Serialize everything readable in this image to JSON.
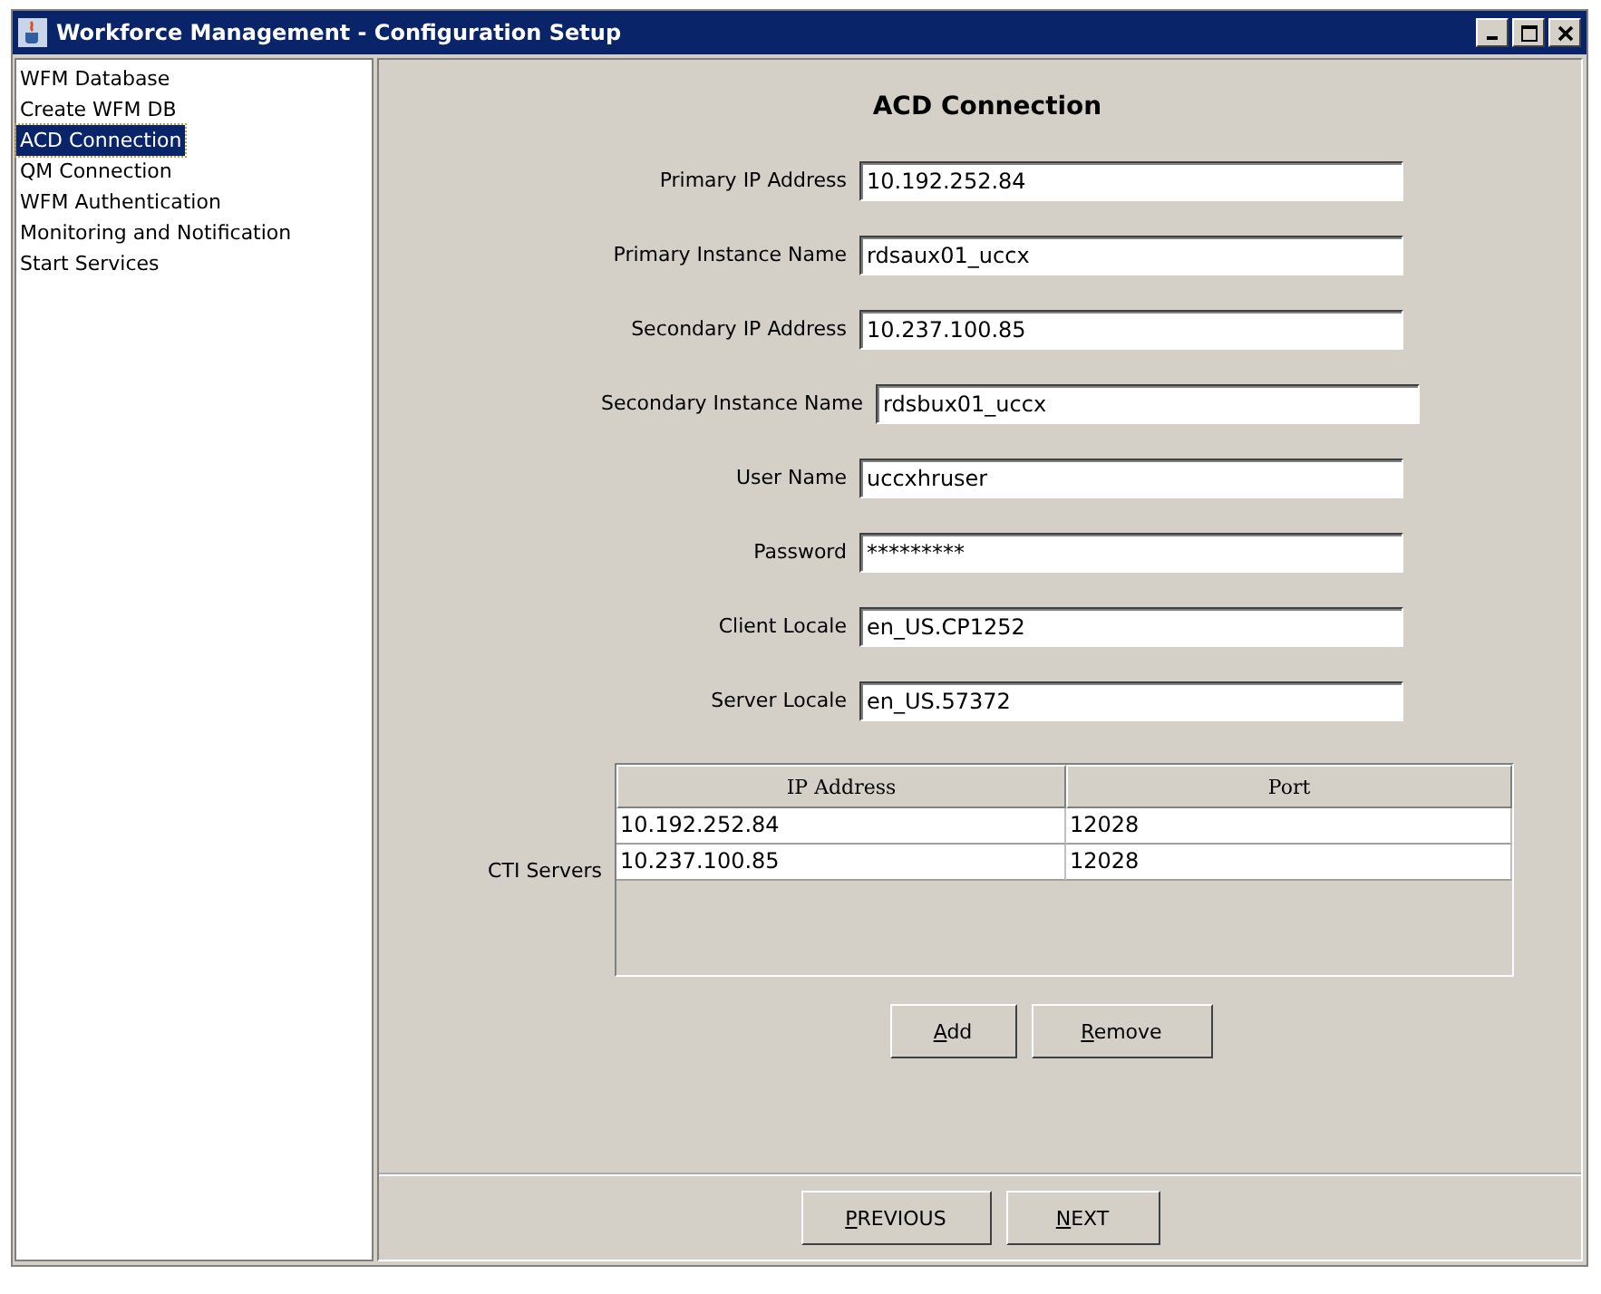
{
  "window": {
    "title": "Workforce Management - Configuration Setup"
  },
  "sidebar": {
    "items": [
      {
        "label": "WFM Database",
        "selected": false
      },
      {
        "label": "Create WFM DB",
        "selected": false
      },
      {
        "label": "ACD Connection",
        "selected": true
      },
      {
        "label": "QM Connection",
        "selected": false
      },
      {
        "label": "WFM Authentication",
        "selected": false
      },
      {
        "label": "Monitoring and Notification",
        "selected": false
      },
      {
        "label": "Start Services",
        "selected": false
      }
    ]
  },
  "form": {
    "heading": "ACD Connection",
    "fields": [
      {
        "label": "Primary IP Address",
        "value": "10.192.252.84"
      },
      {
        "label": "Primary Instance Name",
        "value": "rdsaux01_uccx"
      },
      {
        "label": "Secondary IP Address",
        "value": "10.237.100.85"
      },
      {
        "label": "Secondary Instance Name",
        "value": "rdsbux01_uccx"
      },
      {
        "label": "User Name",
        "value": "uccxhruser"
      },
      {
        "label": "Password",
        "value": "*********"
      },
      {
        "label": "Client Locale",
        "value": "en_US.CP1252"
      },
      {
        "label": "Server Locale",
        "value": "en_US.57372"
      }
    ],
    "cti_servers": {
      "label": "CTI Servers",
      "columns": [
        "IP Address",
        "Port"
      ],
      "rows": [
        [
          "10.192.252.84",
          "12028"
        ],
        [
          "10.237.100.85",
          "12028"
        ]
      ]
    },
    "buttons": [
      "Add",
      "Remove"
    ]
  },
  "footer": {
    "buttons": [
      "PREVIOUS",
      "NEXT"
    ]
  }
}
